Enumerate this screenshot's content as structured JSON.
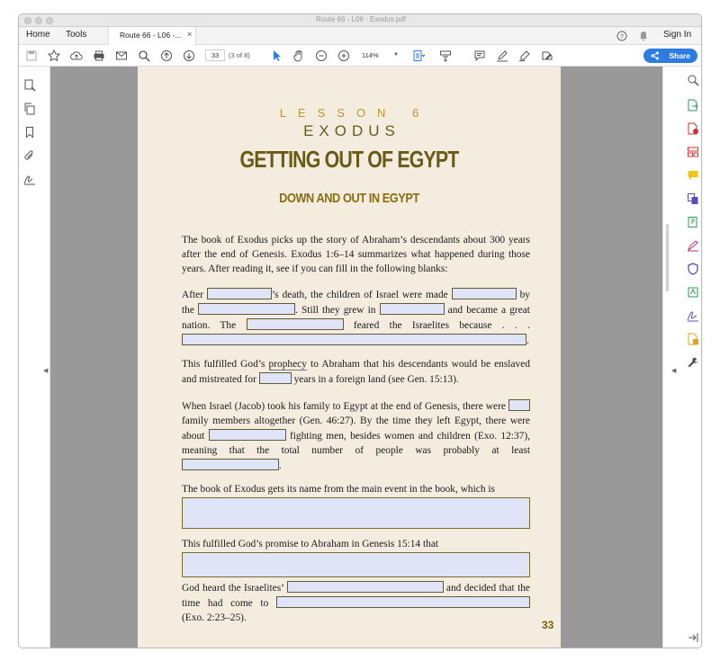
{
  "window": {
    "title": "Route 66 - L06 - Exodus.pdf"
  },
  "menubar": {
    "home": "Home",
    "tools": "Tools",
    "doc_tab": "Route 66 - L06 -...",
    "tab_close": "×",
    "sign_in": "Sign In"
  },
  "toolbar": {
    "page_number": "33",
    "page_count": "(3 of 8)",
    "zoom": "114%",
    "share_label": "Share"
  },
  "page": {
    "lesson_label": "LESSON 6",
    "lesson_name": "EXODUS",
    "heading": "GETTING OUT OF EGYPT",
    "subheading": "DOWN AND OUT IN EGYPT",
    "intro": "The book of Exodus picks up the story of Abraham’s descendants about 300 years after the end of Genesis. Exodus 1:6–14 summarizes what happened during those years. After reading it, see if you can fill in the following blanks:",
    "blanks1": {
      "t1": "After",
      "t2": "’s death, the children of Israel were made",
      "t3": "by the",
      "t4": ". Still they grew in",
      "t5": "and became a great nation. The",
      "t6": "feared the Israelites because . . .",
      "t7": "."
    },
    "prophecy": {
      "t1": "This fulfilled God’s",
      "t1_link": "prophecy",
      "t2": "to Abraham that his descendants would be enslaved and mistreated for",
      "t3": "years in a foreign land (see Gen. 15:13)."
    },
    "jacob": {
      "t1": "When Israel (Jacob) took his family to Egypt at the end of Genesis, there were",
      "t2": "family members altogether (Gen. 46:27). By the time they left Egypt, there were about",
      "t3": "fighting men, besides women and children (Exo. 12:37), meaning that the total number of people was probably at least",
      "t4": "."
    },
    "name": "The book of Exodus gets its name from the main event in the book, which is",
    "promise": "This fulfilled God’s promise to Abraham in Genesis 15:14 that",
    "heard": {
      "t1": "God heard the Israelites’",
      "t2": "and decided that the time had come to",
      "t3": "(Exo. 2:23–25)."
    },
    "page_number": "33"
  },
  "colors": {
    "accent_gold": "#b8972e",
    "heading_olive": "#6a5a16",
    "page_bg": "#f5ece0",
    "field_fill": "#dfe5f7",
    "share_blue": "#2f7ce0"
  }
}
